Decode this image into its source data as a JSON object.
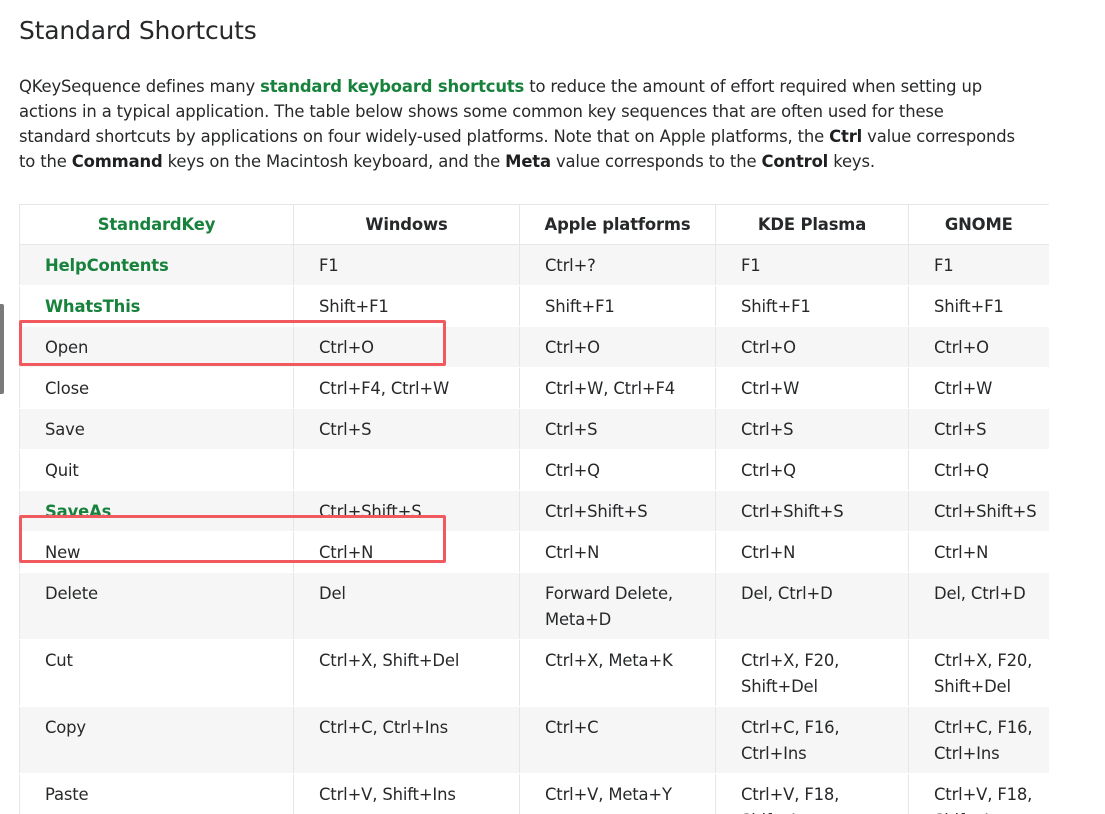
{
  "heading": "Standard Shortcuts",
  "intro": {
    "t1": "QKeySequence defines many ",
    "link": "standard keyboard shortcuts",
    "t2": " to reduce the amount of effort required when setting up actions in a typical application. The table below shows some common key sequences that are often used for these standard shortcuts by applications on four widely-used platforms. Note that on Apple platforms, the ",
    "b1": "Ctrl",
    "t3": " value corresponds to the ",
    "b2": "Command",
    "t4": " keys on the Macintosh keyboard, and the ",
    "b3": "Meta",
    "t5": " value corresponds to the ",
    "b4": "Control",
    "t6": " keys."
  },
  "table": {
    "headers": [
      "StandardKey",
      "Windows",
      "Apple platforms",
      "KDE Plasma",
      "GNOME"
    ],
    "rows": [
      {
        "key": "HelpContents",
        "link": true,
        "win": "F1",
        "apple": "Ctrl+?",
        "kde": "F1",
        "gnome": "F1"
      },
      {
        "key": "WhatsThis",
        "link": true,
        "win": "Shift+F1",
        "apple": "Shift+F1",
        "kde": "Shift+F1",
        "gnome": "Shift+F1"
      },
      {
        "key": "Open",
        "link": false,
        "win": "Ctrl+O",
        "apple": "Ctrl+O",
        "kde": "Ctrl+O",
        "gnome": "Ctrl+O"
      },
      {
        "key": "Close",
        "link": false,
        "win": "Ctrl+F4, Ctrl+W",
        "apple": "Ctrl+W, Ctrl+F4",
        "kde": "Ctrl+W",
        "gnome": "Ctrl+W"
      },
      {
        "key": "Save",
        "link": false,
        "win": "Ctrl+S",
        "apple": "Ctrl+S",
        "kde": "Ctrl+S",
        "gnome": "Ctrl+S"
      },
      {
        "key": "Quit",
        "link": false,
        "win": "",
        "apple": "Ctrl+Q",
        "kde": "Ctrl+Q",
        "gnome": "Ctrl+Q"
      },
      {
        "key": "SaveAs",
        "link": true,
        "win": "Ctrl+Shift+S",
        "apple": "Ctrl+Shift+S",
        "kde": "Ctrl+Shift+S",
        "gnome": "Ctrl+Shift+S"
      },
      {
        "key": "New",
        "link": false,
        "win": "Ctrl+N",
        "apple": "Ctrl+N",
        "kde": "Ctrl+N",
        "gnome": "Ctrl+N"
      },
      {
        "key": "Delete",
        "link": false,
        "win": "Del",
        "apple": [
          "Forward Delete,",
          "Meta+D"
        ],
        "kde": "Del, Ctrl+D",
        "gnome": "Del, Ctrl+D"
      },
      {
        "key": "Cut",
        "link": false,
        "win": "Ctrl+X, Shift+Del",
        "apple": "Ctrl+X, Meta+K",
        "kde": [
          "Ctrl+X, F20,",
          "Shift+Del"
        ],
        "gnome": [
          "Ctrl+X, F20,",
          "Shift+Del"
        ]
      },
      {
        "key": "Copy",
        "link": false,
        "win": "Ctrl+C, Ctrl+Ins",
        "apple": "Ctrl+C",
        "kde": [
          "Ctrl+C, F16,",
          "Ctrl+Ins"
        ],
        "gnome": [
          "Ctrl+C, F16,",
          "Ctrl+Ins"
        ]
      },
      {
        "key": "Paste",
        "link": false,
        "win": "Ctrl+V, Shift+Ins",
        "apple": "Ctrl+V, Meta+Y",
        "kde": [
          "Ctrl+V, F18,",
          "Shift+Ins"
        ],
        "gnome": [
          "Ctrl+V, F18,",
          "Shift+Ins"
        ]
      }
    ]
  },
  "highlights": [
    "Open",
    "New"
  ],
  "colors": {
    "link": "#17823b",
    "highlight": "#f05a5e",
    "stripe": "#f6f6f6"
  }
}
